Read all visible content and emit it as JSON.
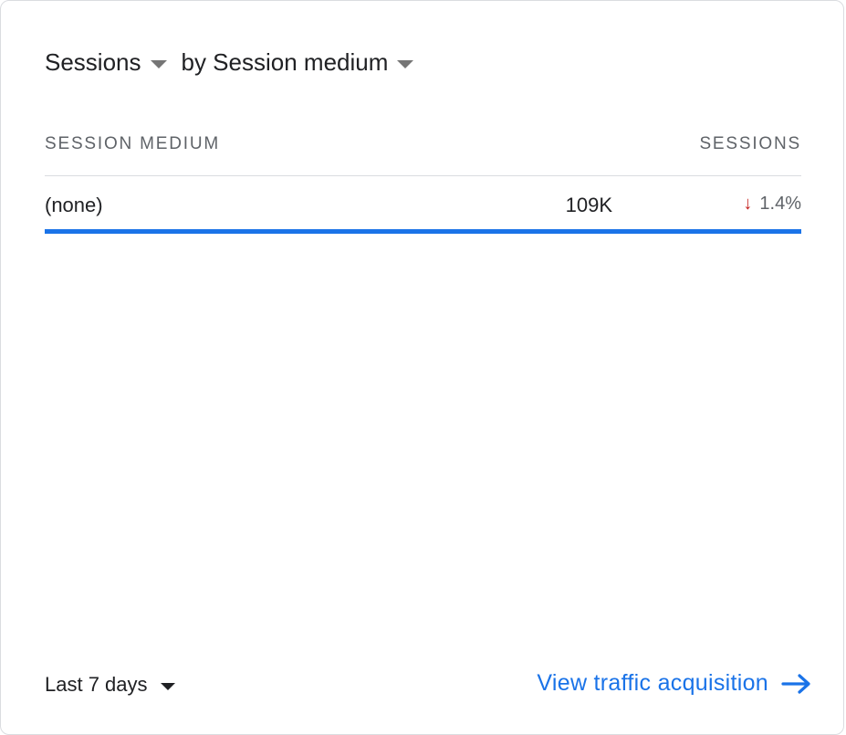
{
  "header": {
    "metric_label": "Sessions",
    "dimension_label": "by Session medium"
  },
  "table": {
    "columns": [
      "SESSION MEDIUM",
      "SESSIONS"
    ],
    "rows": [
      {
        "label": "(none)",
        "value": "109K",
        "change": "1.4%",
        "change_direction": "down",
        "share_fraction": 1.0
      }
    ]
  },
  "footer": {
    "date_range": "Last 7 days",
    "link_label": "View traffic acquisition"
  },
  "colors": {
    "accent": "#1a73e8",
    "negative": "#c5221f"
  },
  "icons": {
    "metric_dropdown": "caret-down-icon",
    "dimension_dropdown": "caret-down-icon",
    "change_direction": "arrow-down-icon",
    "date_dropdown": "caret-down-icon",
    "link_arrow": "arrow-right-icon"
  }
}
